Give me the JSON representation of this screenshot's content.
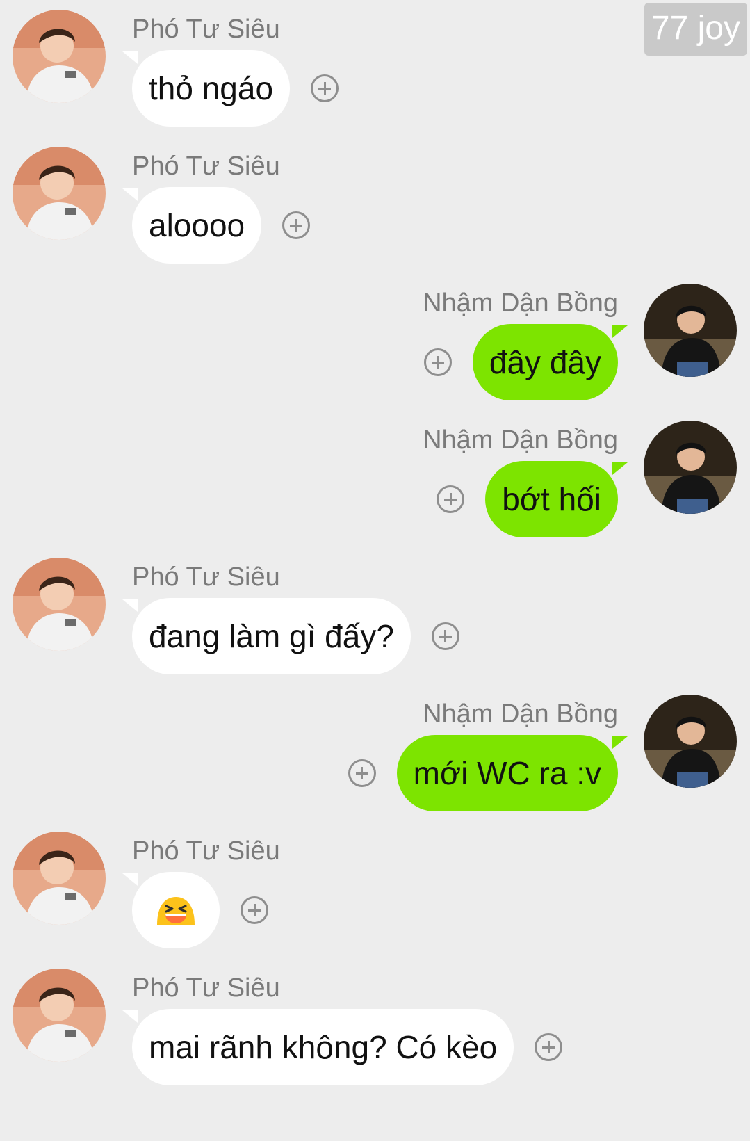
{
  "watermark": "77 joy",
  "users": {
    "left_name": "Phó Tư Siêu",
    "right_name": "Nhậm Dận Bồng"
  },
  "messages": [
    {
      "side": "left",
      "name": "Phó Tư Siêu",
      "text": "thỏ ngáo"
    },
    {
      "side": "left",
      "name": "Phó Tư Siêu",
      "text": "aloooo"
    },
    {
      "side": "right",
      "name": "Nhậm Dận Bồng",
      "text": "đây đây"
    },
    {
      "side": "right",
      "name": "Nhậm Dận Bồng",
      "text": "bớt hối"
    },
    {
      "side": "left",
      "name": "Phó Tư Siêu",
      "text": "đang làm gì đấy?"
    },
    {
      "side": "right",
      "name": "Nhậm Dận Bồng",
      "text": "mới WC ra :v"
    },
    {
      "side": "left",
      "name": "Phó Tư Siêu",
      "text": "",
      "emoji": "laughing-face-emoji"
    },
    {
      "side": "left",
      "name": "Phó Tư Siêu",
      "text": "mai rãnh không? Có kèo"
    }
  ],
  "icons": {
    "reaction": "plus-circle-icon",
    "left_avatar": "avatar-pho-tu-sieu",
    "right_avatar": "avatar-nham-dan-bong"
  },
  "colors": {
    "background": "#ededed",
    "incoming_bubble": "#ffffff",
    "outgoing_bubble": "#7de400",
    "name_text": "#7a7a7a",
    "message_text": "#111111"
  }
}
